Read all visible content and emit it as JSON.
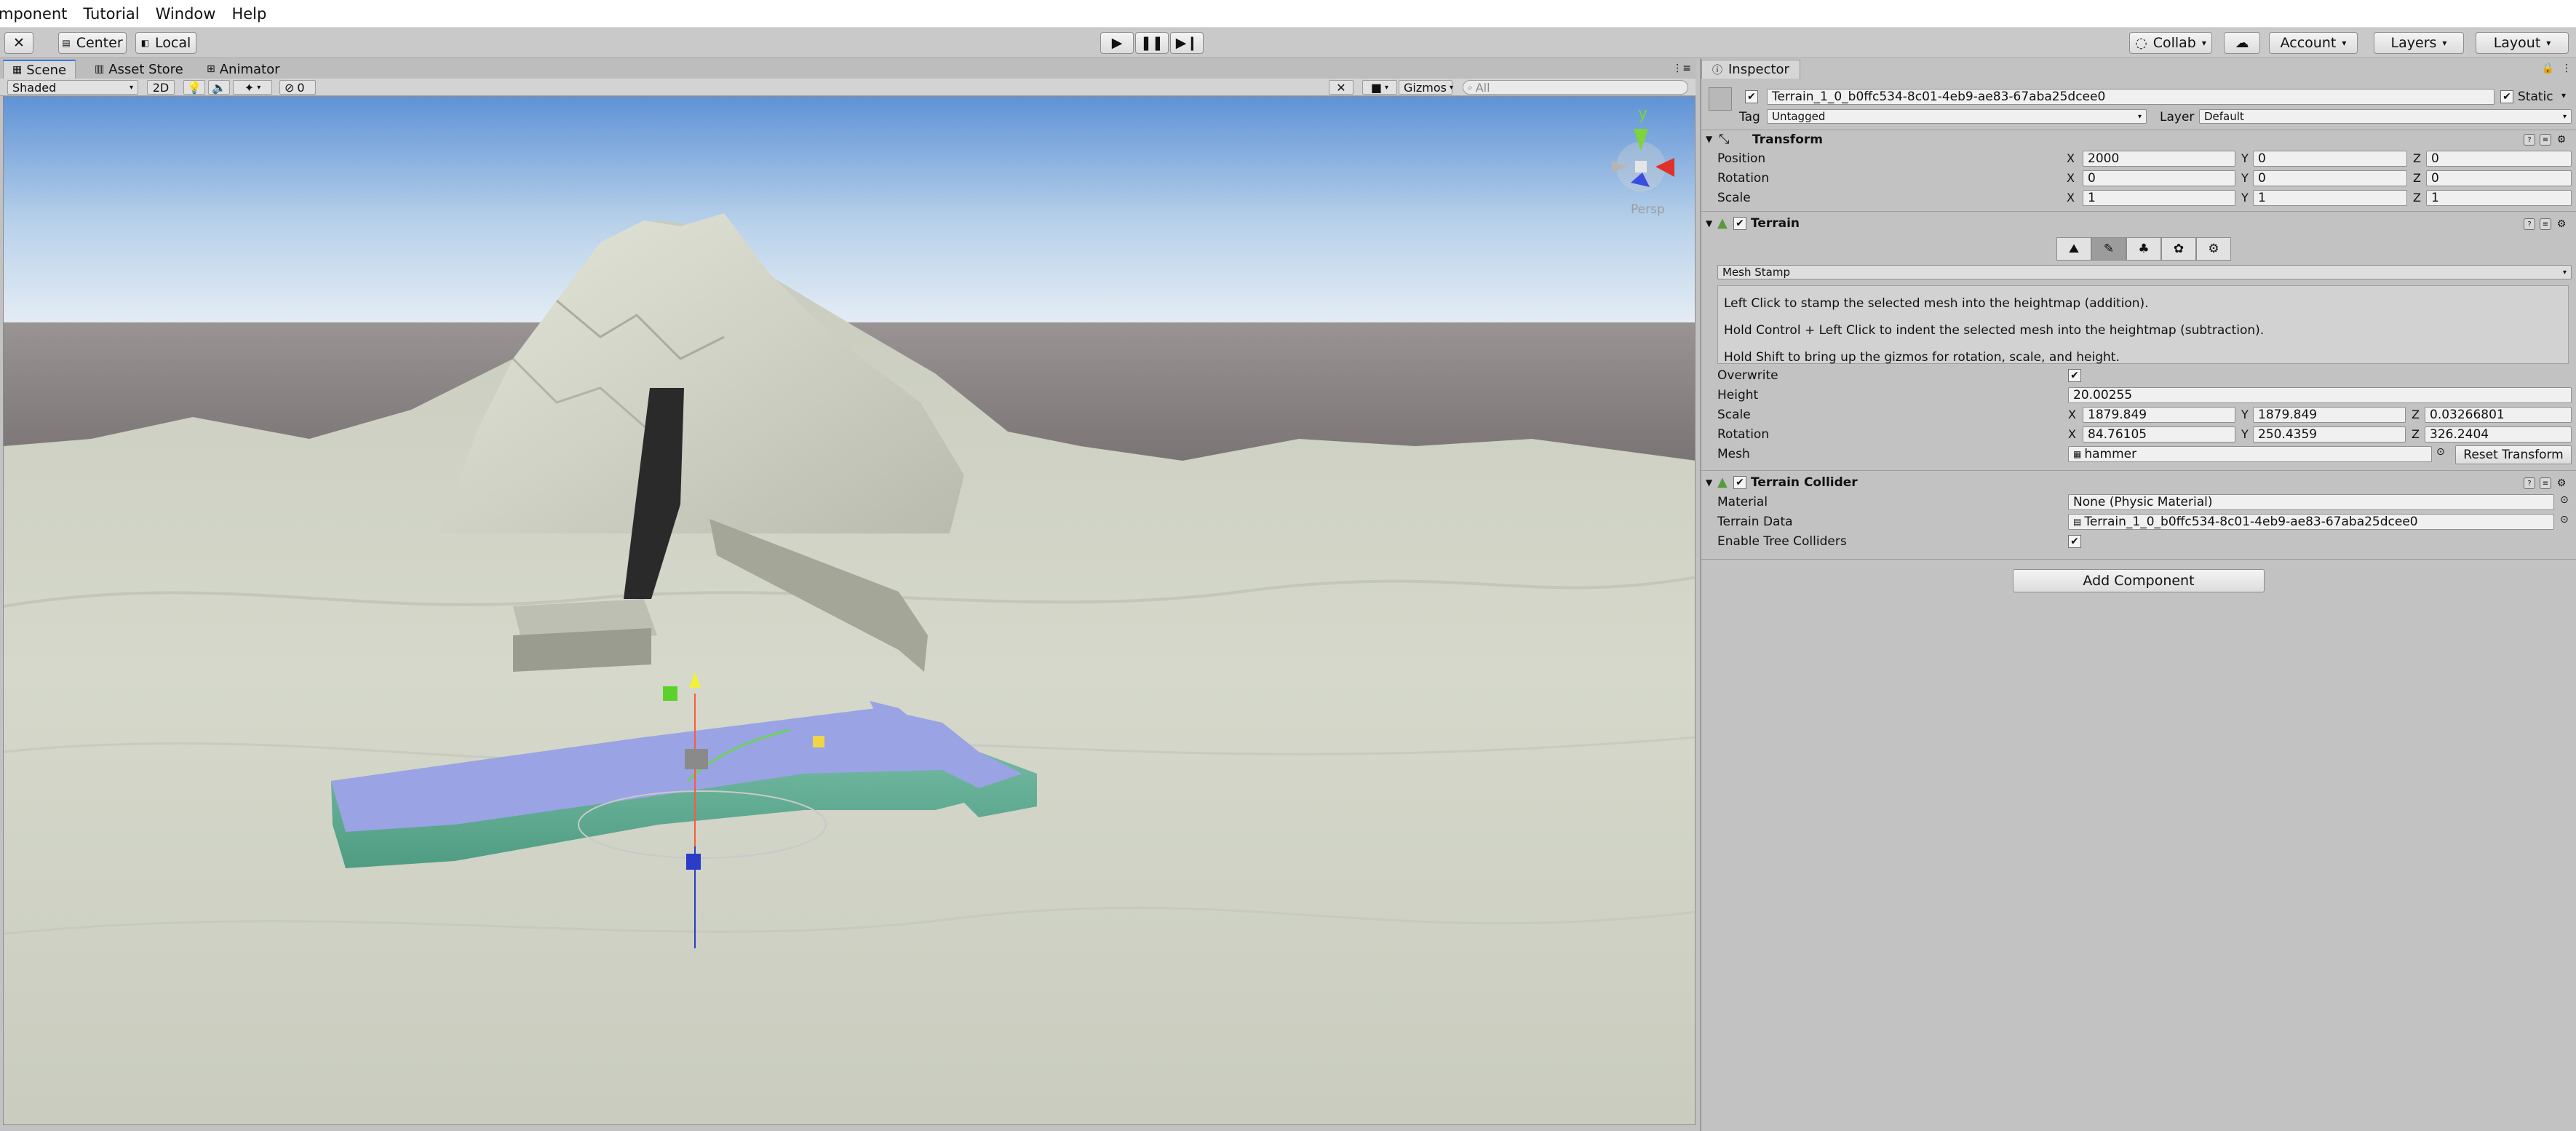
{
  "menu": [
    "mponent",
    "Tutorial",
    "Window",
    "Help"
  ],
  "toolbar": {
    "center": "Center",
    "local": "Local",
    "collab": "Collab",
    "account": "Account",
    "layers": "Layers",
    "layout": "Layout"
  },
  "scene_tabs": {
    "scene": "Scene",
    "asset_store": "Asset Store",
    "animator": "Animator"
  },
  "scene_bar": {
    "shading": "Shaded",
    "mode_2d": "2D",
    "hidden_count": "0",
    "gizmos": "Gizmos",
    "search_placeholder": "All"
  },
  "viewport": {
    "persp_label": "Persp",
    "gizmo_y": "y"
  },
  "inspector": {
    "tab": "Inspector",
    "object_name": "Terrain_1_0_b0ffc534-8c01-4eb9-ae83-67aba25dcee0",
    "static_label": "Static",
    "tag_label": "Tag",
    "tag_value": "Untagged",
    "layer_label": "Layer",
    "layer_value": "Default",
    "transform": {
      "title": "Transform",
      "position_label": "Position",
      "rotation_label": "Rotation",
      "scale_label": "Scale",
      "position": {
        "x": "2000",
        "y": "0",
        "z": "0"
      },
      "rotation": {
        "x": "0",
        "y": "0",
        "z": "0"
      },
      "scale": {
        "x": "1",
        "y": "1",
        "z": "1"
      }
    },
    "terrain": {
      "title": "Terrain",
      "tool_dropdown": "Mesh Stamp",
      "help_lines": [
        "Left Click to stamp the selected mesh into the heightmap (addition).",
        "Hold Control + Left Click to indent the selected mesh into the heightmap (subtraction).",
        "Hold Shift to bring up the gizmos for rotation, scale, and height."
      ],
      "overwrite_label": "Overwrite",
      "height_label": "Height",
      "height_value": "20.00255",
      "scale_label": "Scale",
      "scale": {
        "x": "1879.849",
        "y": "1879.849",
        "z": "0.03266801"
      },
      "rotation_label": "Rotation",
      "rotation": {
        "x": "84.76105",
        "y": "250.4359",
        "z": "326.2404"
      },
      "mesh_label": "Mesh",
      "mesh_value": "hammer",
      "reset_transform": "Reset Transform"
    },
    "collider": {
      "title": "Terrain Collider",
      "material_label": "Material",
      "material_value": "None (Physic Material)",
      "terrain_data_label": "Terrain Data",
      "terrain_data_value": "Terrain_1_0_b0ffc534-8c01-4eb9-ae83-67aba25dcee0",
      "tree_colliders_label": "Enable Tree Colliders"
    },
    "add_component": "Add Component"
  },
  "axis_labels": {
    "x": "X",
    "y": "Y",
    "z": "Z"
  },
  "colors": {
    "sky_top": "#5f93d6",
    "sky_horizon": "#dce9f5",
    "ground_band": "#6f6a6a",
    "terrain": "#d4d7c9",
    "stamp_top": "#9aa3e4",
    "stamp_side": "#6fb9a0",
    "accent_blue": "#3a79d9"
  }
}
